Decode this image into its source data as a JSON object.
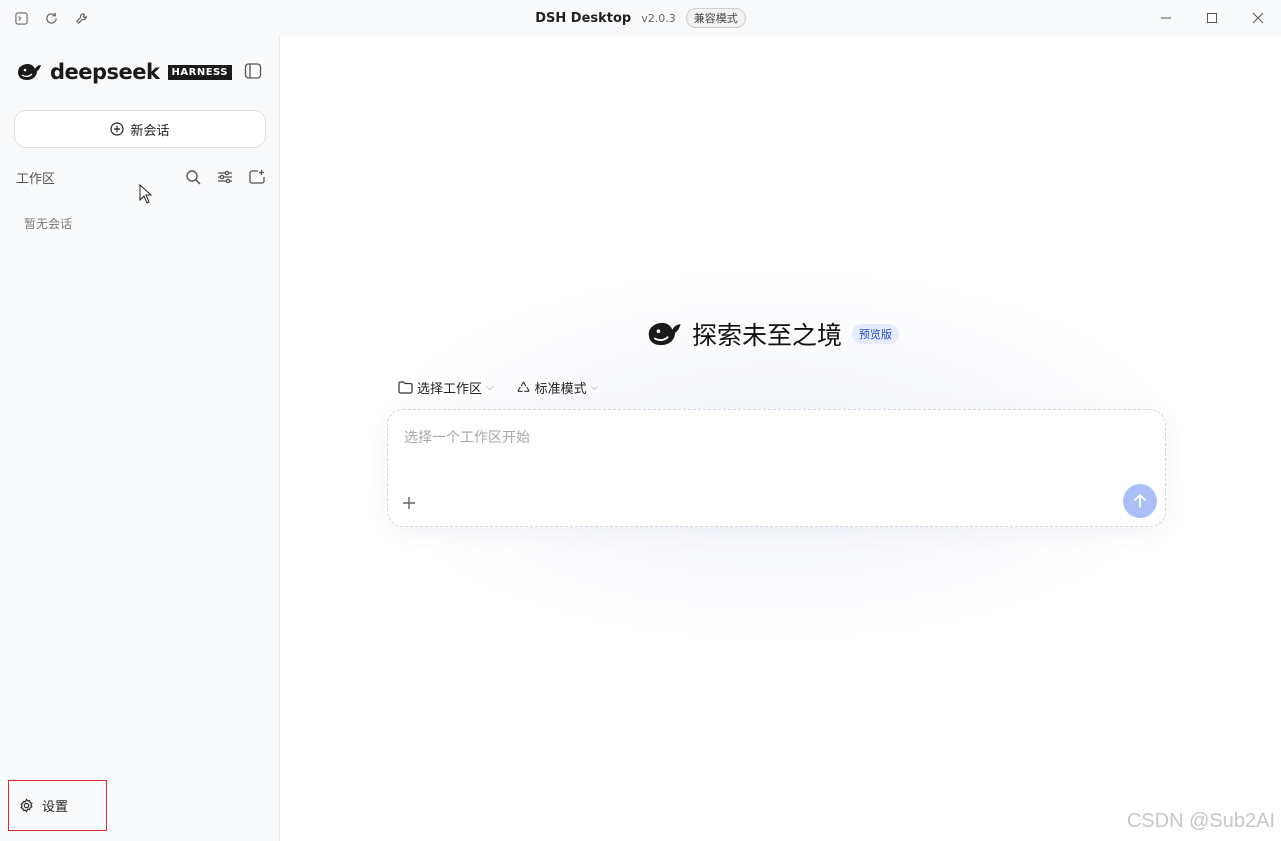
{
  "titlebar": {
    "app_title": "DSH Desktop",
    "version": "v2.0.3",
    "compat_badge": "兼容模式"
  },
  "sidebar": {
    "brand": "deepseek",
    "brand_tag": "HARNESS",
    "new_chat_label": "新会话",
    "workspace_title": "工作区",
    "empty_text": "暂无会话",
    "settings_label": "设置"
  },
  "main": {
    "hero_title": "探索未至之境",
    "preview_badge": "预览版",
    "workspace_selector": "选择工作区",
    "mode_selector": "标准模式",
    "composer_placeholder": "选择一个工作区开始"
  },
  "watermark": "CSDN @Sub2AI",
  "icons": {
    "terminal": "terminal-icon",
    "reload": "reload-icon",
    "wrench": "wrench-icon",
    "minimize": "minimize-icon",
    "maximize": "maximize-icon",
    "close": "close-icon",
    "sidebar_toggle": "sidebar-toggle-icon",
    "plus_circle": "plus-circle-icon",
    "search": "search-icon",
    "filter": "filter-icon",
    "new_folder": "new-folder-icon",
    "gear": "gear-icon",
    "folder": "folder-icon",
    "recycle": "mode-icon",
    "plus": "plus-icon",
    "arrow_up": "arrow-up-icon"
  },
  "colors": {
    "send_button": "#a9bff6",
    "preview_badge_bg": "#e6ecfc",
    "preview_badge_text": "#2b4bc9",
    "settings_highlight": "#e0292b"
  }
}
